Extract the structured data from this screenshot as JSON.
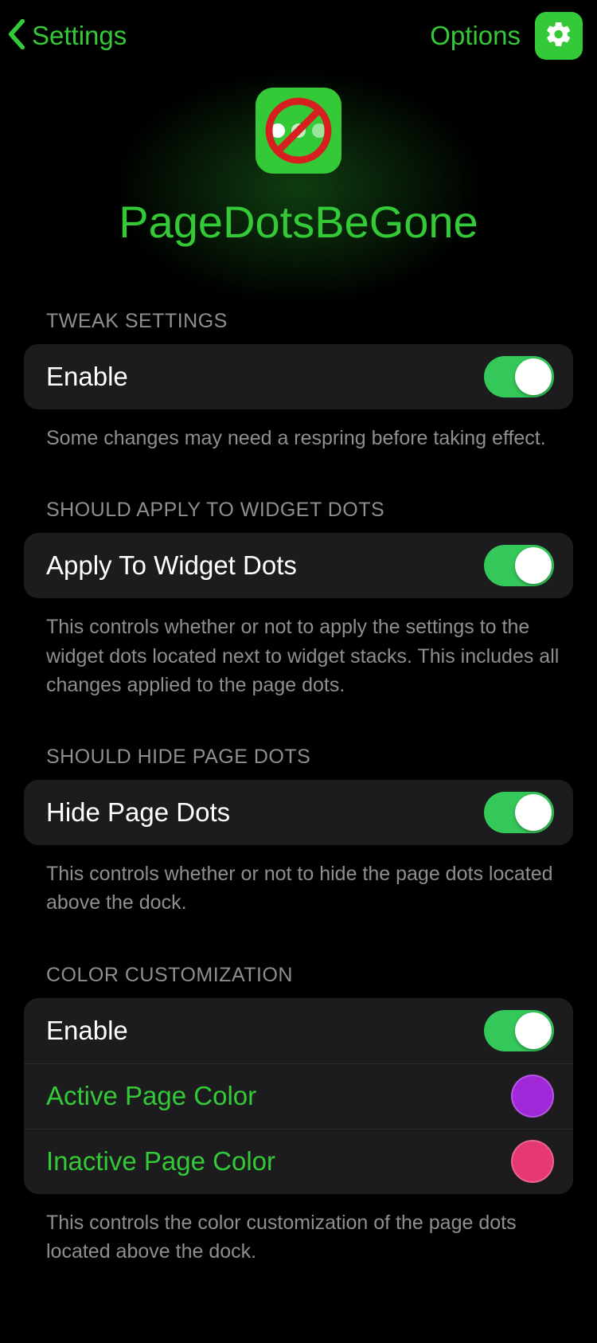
{
  "header": {
    "back_label": "Settings",
    "options_label": "Options"
  },
  "hero": {
    "title": "PageDotsBeGone"
  },
  "sections": {
    "tweak": {
      "header": "TWEAK SETTINGS",
      "enable_label": "Enable",
      "footer": "Some changes may need a respring before taking effect."
    },
    "widget": {
      "header": "SHOULD APPLY TO WIDGET DOTS",
      "label": "Apply To Widget Dots",
      "footer": "This controls whether or not to apply the settings to the widget dots located next to widget stacks. This includes all changes applied to the page dots."
    },
    "hide": {
      "header": "SHOULD HIDE PAGE DOTS",
      "label": "Hide Page Dots",
      "footer": "This controls whether or not to hide the page dots located above the dock."
    },
    "color": {
      "header": "COLOR CUSTOMIZATION",
      "enable_label": "Enable",
      "active_label": "Active Page Color",
      "active_color": "#a028d8",
      "inactive_label": "Inactive Page Color",
      "inactive_color": "#e63972",
      "footer": "This controls the color customization of the page dots located above the dock."
    }
  }
}
